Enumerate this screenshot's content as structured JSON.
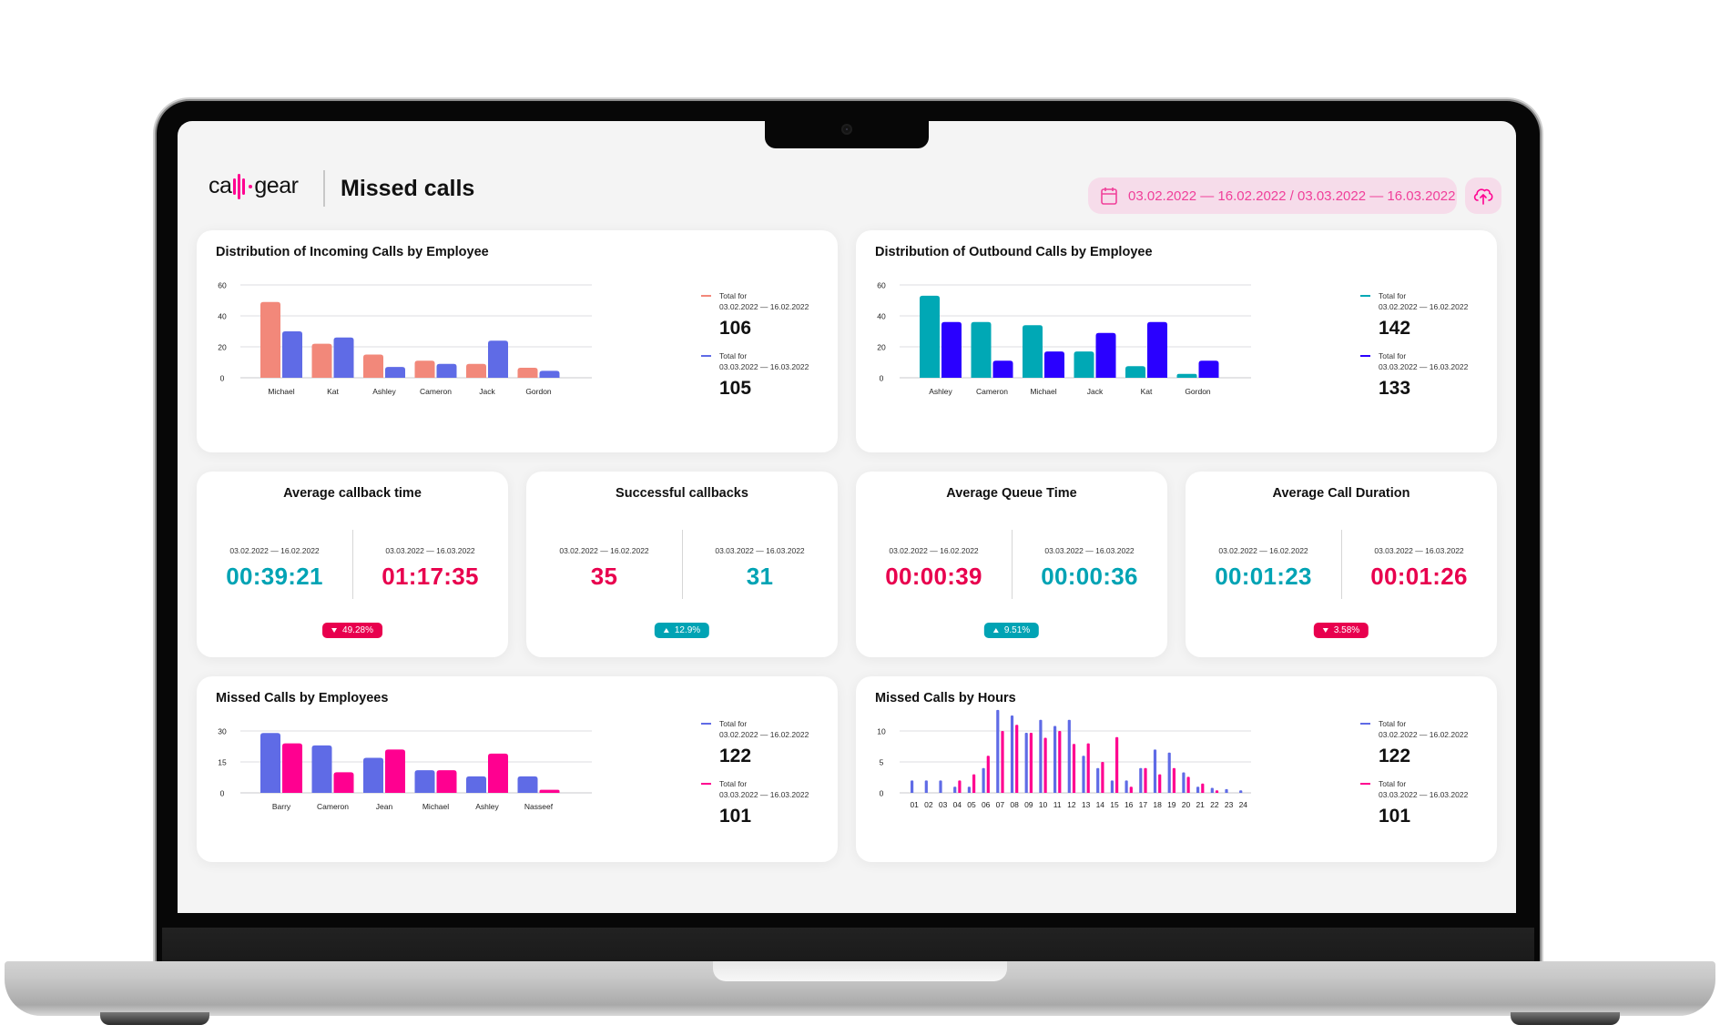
{
  "header": {
    "brand": "call gear",
    "brand_left": "ca",
    "brand_right": "gear",
    "title": "Missed calls",
    "date_range": "03.02.2022 — 16.02.2022 / 03.03.2022 — 16.03.2022",
    "calendar_icon": "calendar-icon",
    "upload_icon": "cloud-upload-icon"
  },
  "colors": {
    "accent_pink": "#ff0090",
    "period1_incoming": "#f2887a",
    "period2_incoming": "#5f6be6",
    "period1_outbound": "#00a8b5",
    "period2_outbound": "#2a00ff",
    "missed_period1": "#5f6be6",
    "missed_period2": "#ff0090",
    "stat_teal": "#00a3b4",
    "stat_red": "#e8004e",
    "pill_bg": "#f6dcea",
    "pill_text": "#f0409a"
  },
  "legend_caption": "Total for",
  "period1": "03.02.2022 — 16.02.2022",
  "period2": "03.03.2022 — 16.03.2022",
  "chart_data": [
    {
      "id": "incoming",
      "type": "bar",
      "title": "Distribution of Incoming Calls by Employee",
      "categories": [
        "Michael",
        "Kat",
        "Ashley",
        "Cameron",
        "Jack",
        "Gordon"
      ],
      "series": [
        {
          "name": "Total for 03.02.2022 — 16.02.2022",
          "color": "#f2887a",
          "values": [
            49,
            22,
            15,
            11,
            9,
            6.5
          ],
          "total": "106"
        },
        {
          "name": "Total for 03.03.2022 — 16.03.2022",
          "color": "#5f6be6",
          "values": [
            30,
            26,
            7,
            9,
            24,
            4.5
          ],
          "total": "105"
        }
      ],
      "yticks": [
        0,
        20,
        40,
        60
      ],
      "ylim": [
        0,
        60
      ],
      "grid": true,
      "legend": "right"
    },
    {
      "id": "outbound",
      "type": "bar",
      "title": "Distribution of Outbound Calls by Employee",
      "categories": [
        "Ashley",
        "Cameron",
        "Michael",
        "Jack",
        "Kat",
        "Gordon"
      ],
      "series": [
        {
          "name": "Total for 03.02.2022 — 16.02.2022",
          "color": "#00a8b5",
          "values": [
            53,
            36,
            34,
            17,
            7.5,
            2.5
          ],
          "total": "142"
        },
        {
          "name": "Total for 03.03.2022 — 16.03.2022",
          "color": "#2a00ff",
          "values": [
            36,
            11,
            17,
            29,
            36,
            11
          ],
          "total": "133"
        }
      ],
      "yticks": [
        0,
        20,
        40,
        60
      ],
      "ylim": [
        0,
        60
      ],
      "grid": true,
      "legend": "right"
    },
    {
      "id": "missed-employees",
      "type": "bar",
      "title": "Missed Calls by Employees",
      "categories": [
        "Barry",
        "Cameron",
        "Jean",
        "Michael",
        "Ashley",
        "Nasseef"
      ],
      "series": [
        {
          "name": "Total for 03.02.2022 — 16.02.2022",
          "color": "#5f6be6",
          "values": [
            29,
            23,
            17,
            11,
            8,
            8
          ],
          "total": "122"
        },
        {
          "name": "Total for 03.03.2022 — 16.03.2022",
          "color": "#ff0090",
          "values": [
            24,
            10,
            21,
            11,
            19,
            1.5
          ],
          "total": "101"
        }
      ],
      "yticks": [
        0,
        15,
        30
      ],
      "ylim": [
        0,
        30
      ],
      "grid": true,
      "legend": "right"
    },
    {
      "id": "missed-hours",
      "type": "bar",
      "title": "Missed Calls by Hours",
      "categories": [
        "01",
        "02",
        "03",
        "04",
        "05",
        "06",
        "07",
        "08",
        "09",
        "10",
        "11",
        "12",
        "13",
        "14",
        "15",
        "16",
        "17",
        "18",
        "19",
        "20",
        "21",
        "22",
        "23",
        "24"
      ],
      "series": [
        {
          "name": "Total for 03.02.2022 — 16.02.2022",
          "color": "#5f6be6",
          "values": [
            2,
            2,
            2,
            1,
            1,
            4,
            13.4,
            12.5,
            9.7,
            11.8,
            10.8,
            11.8,
            6,
            4,
            2,
            2,
            4,
            7,
            6.5,
            3.3,
            1,
            0.8,
            0.6,
            0.4
          ],
          "total": "122"
        },
        {
          "name": "Total for 03.03.2022 — 16.03.2022",
          "color": "#ff0090",
          "values": [
            0,
            0,
            0,
            2,
            3,
            6,
            10,
            11,
            9.7,
            8.9,
            10,
            7.9,
            8,
            5,
            9,
            1,
            4,
            3,
            4,
            2.6,
            1.5,
            0.4,
            0,
            0
          ],
          "total": "101"
        }
      ],
      "yticks": [
        0,
        5,
        10
      ],
      "ylim": [
        0,
        13.5
      ],
      "grid": true,
      "legend": "right"
    }
  ],
  "stats": [
    {
      "title": "Average callback time",
      "period1": "03.02.2022 — 16.02.2022",
      "value1": "00:39:21",
      "color1": "#00a3b4",
      "period2": "03.03.2022 — 16.03.2022",
      "value2": "01:17:35",
      "color2": "#e8004e",
      "badge": "49.28%",
      "badge_direction": "down",
      "badge_color": "#e8004e"
    },
    {
      "title": "Successful callbacks",
      "period1": "03.02.2022 — 16.02.2022",
      "value1": "35",
      "color1": "#e8004e",
      "period2": "03.03.2022 — 16.03.2022",
      "value2": "31",
      "color2": "#00a3b4",
      "badge": "12.9%",
      "badge_direction": "up",
      "badge_color": "#00a3b4"
    },
    {
      "title": "Average Queue Time",
      "period1": "03.02.2022 — 16.02.2022",
      "value1": "00:00:39",
      "color1": "#e8004e",
      "period2": "03.03.2022 — 16.03.2022",
      "value2": "00:00:36",
      "color2": "#00a3b4",
      "badge": "9.51%",
      "badge_direction": "up",
      "badge_color": "#00a3b4"
    },
    {
      "title": "Average Call Duration",
      "period1": "03.02.2022 — 16.02.2022",
      "value1": "00:01:23",
      "color1": "#00a3b4",
      "period2": "03.03.2022 — 16.03.2022",
      "value2": "00:01:26",
      "color2": "#e8004e",
      "badge": "3.58%",
      "badge_direction": "down",
      "badge_color": "#e8004e"
    }
  ]
}
